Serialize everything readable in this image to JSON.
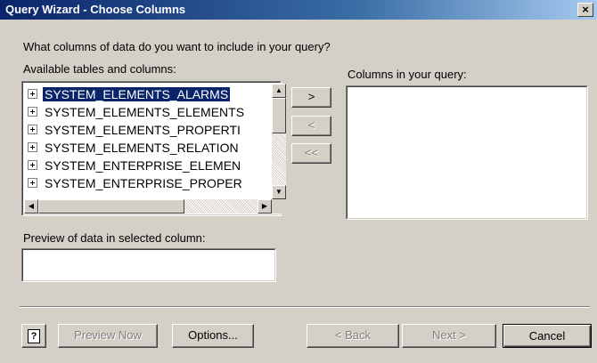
{
  "window": {
    "title": "Query Wizard - Choose Columns",
    "close_glyph": "×"
  },
  "prompt": "What columns of data do you want to include in your query?",
  "available": {
    "label": "Available tables and columns:",
    "items": [
      {
        "label": "SYSTEM_ELEMENTS_ALARMS",
        "selected": true
      },
      {
        "label": "SYSTEM_ELEMENTS_ELEMENTS"
      },
      {
        "label": "SYSTEM_ELEMENTS_PROPERTI"
      },
      {
        "label": "SYSTEM_ELEMENTS_RELATION"
      },
      {
        "label": "SYSTEM_ENTERPRISE_ELEMEN"
      },
      {
        "label": "SYSTEM_ENTERPRISE_PROPER"
      }
    ]
  },
  "move_buttons": {
    "add": ">",
    "remove": "<",
    "remove_all": "<<"
  },
  "query_columns": {
    "label": "Columns in your query:"
  },
  "preview": {
    "label": "Preview of data in selected column:",
    "value": ""
  },
  "footer": {
    "help": "?",
    "preview_now": "Preview Now",
    "options": "Options...",
    "back": "< Back",
    "next": "Next >",
    "cancel": "Cancel"
  },
  "icons": {
    "scroll_up": "▲",
    "scroll_down": "▼",
    "scroll_left": "◀",
    "scroll_right": "▶"
  },
  "colors": {
    "title_bar": "#0a246a",
    "selection": "#0a246a",
    "dialog_bg": "#d4d0c8"
  }
}
